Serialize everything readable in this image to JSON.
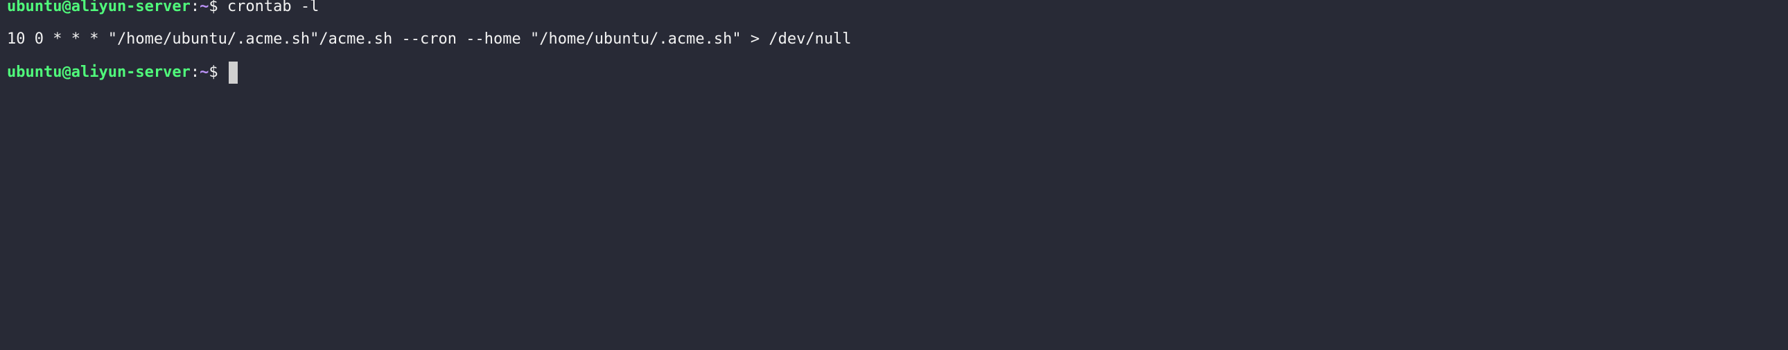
{
  "terminal": {
    "line1": {
      "user_host": "ubuntu@aliyun-server",
      "separator": ":",
      "path": "~",
      "prompt_symbol": "$",
      "command": "crontab -l"
    },
    "output": "10 0 * * * \"/home/ubuntu/.acme.sh\"/acme.sh --cron --home \"/home/ubuntu/.acme.sh\" > /dev/null",
    "line3": {
      "user_host": "ubuntu@aliyun-server",
      "separator": ":",
      "path": "~",
      "prompt_symbol": "$"
    },
    "colors": {
      "background": "#282a36",
      "user_host": "#50fa7b",
      "path": "#bd93f9",
      "text": "#f2f2f2",
      "cursor": "#d0d0d0"
    }
  }
}
